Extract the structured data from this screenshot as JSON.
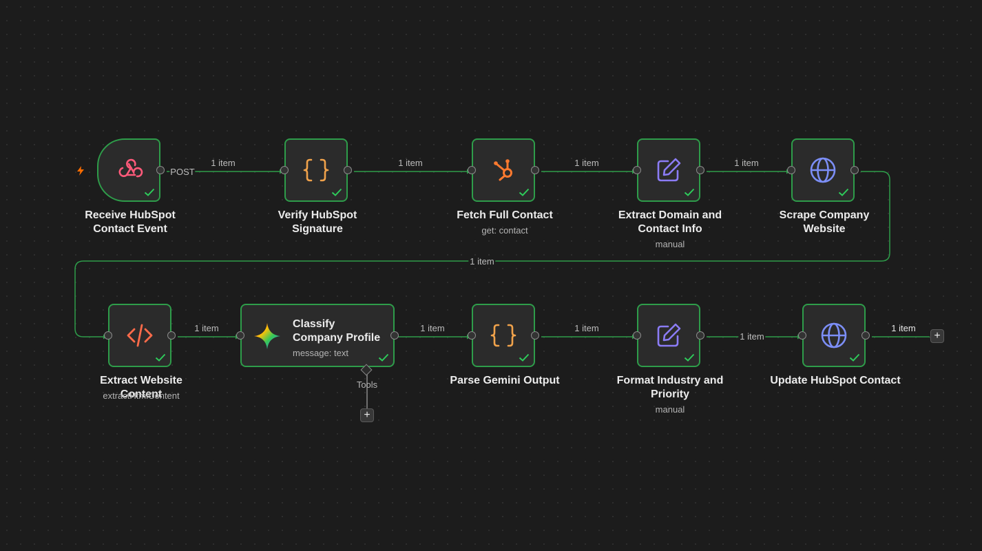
{
  "colors": {
    "accent": "#2e9d4a",
    "trigger": "#ff6d00",
    "webhook": "#ff5a7a",
    "code": "#f0a24b",
    "hubspot": "#ff7a2f",
    "edit": "#8b7cf6",
    "globe": "#7c8ef6",
    "html": "#ff6b4a"
  },
  "nodes": {
    "receive": {
      "label_1": "Receive HubSpot",
      "label_2": "Contact Event",
      "icon": "webhook-icon"
    },
    "verify": {
      "label_1": "Verify HubSpot",
      "label_2": "Signature",
      "icon": "braces-icon"
    },
    "fetch": {
      "label_1": "Fetch Full Contact",
      "sub": "get: contact",
      "icon": "hubspot-icon"
    },
    "extract_domain": {
      "label_1": "Extract Domain and",
      "label_2": "Contact Info",
      "sub": "manual",
      "icon": "edit-icon"
    },
    "scrape": {
      "label_1": "Scrape Company",
      "label_2": "Website",
      "icon": "globe-icon"
    },
    "extract_web": {
      "label_1": "Extract Website Content",
      "sub": "extractHtmlContent",
      "icon": "code-icon"
    },
    "classify": {
      "label_1": "Classify",
      "label_2": "Company Profile",
      "sub": "message: text",
      "tools": "Tools",
      "icon": "gemini-icon"
    },
    "parse": {
      "label_1": "Parse Gemini Output",
      "icon": "braces-icon"
    },
    "format": {
      "label_1": "Format Industry and",
      "label_2": "Priority",
      "sub": "manual",
      "icon": "edit-icon"
    },
    "update": {
      "label_1": "Update HubSpot Contact",
      "icon": "globe-icon"
    }
  },
  "edges": {
    "post_label": "POST",
    "e1": "1 item",
    "e2": "1 item",
    "e3": "1 item",
    "e4": "1 item",
    "e5": "1 item",
    "e6": "1 item",
    "e7": "1 item",
    "e8": "1 item",
    "e9": "1 item",
    "e10": "1 item"
  },
  "buttons": {
    "add_after": "+",
    "add_tool": "+"
  }
}
